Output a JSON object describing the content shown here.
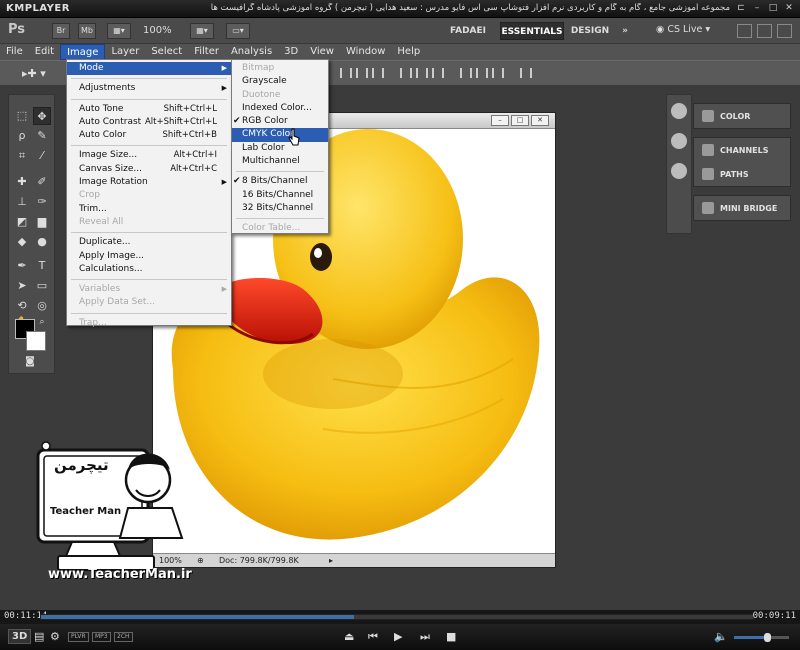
{
  "player": {
    "name": "KMPLAYER",
    "caption": "مجموعه آموزشی جامع ، گام به گام و کاربردی نرم افزار فتوشاپ سی اس فایو   مدرس : سعید هدایی ( تیچرمن ) گروه آموزشی پادشاه گرافیست ها",
    "time_elapsed": "00:11:14",
    "time_total": "00:09:11",
    "progress": 0.44,
    "volume": 0.6,
    "badges": [
      "PLVR",
      "MP3",
      "2CH"
    ],
    "btn_3d": "3D"
  },
  "appbar": {
    "logo": "Ps",
    "bridge_label": "Br",
    "minibridge_label": "Mb",
    "zoom": "100%",
    "workspaces": [
      "FADAEI",
      "ESSENTIALS",
      "DESIGN"
    ],
    "active_workspace": "ESSENTIALS",
    "more": "»",
    "cs_live": "CS Live"
  },
  "menubar": {
    "items": [
      "File",
      "Edit",
      "Image",
      "Layer",
      "Select",
      "Filter",
      "Analysis",
      "3D",
      "View",
      "Window",
      "Help"
    ],
    "open": "Image"
  },
  "image_menu": {
    "items": [
      {
        "label": "Mode",
        "shortcut": "",
        "submenu": true,
        "disabled": false,
        "highlighted": true
      },
      {
        "sep": true
      },
      {
        "label": "Adjustments",
        "shortcut": "",
        "submenu": true,
        "disabled": false
      },
      {
        "sep": true
      },
      {
        "label": "Auto Tone",
        "shortcut": "Shift+Ctrl+L"
      },
      {
        "label": "Auto Contrast",
        "shortcut": "Alt+Shift+Ctrl+L"
      },
      {
        "label": "Auto Color",
        "shortcut": "Shift+Ctrl+B"
      },
      {
        "sep": true
      },
      {
        "label": "Image Size...",
        "shortcut": "Alt+Ctrl+I"
      },
      {
        "label": "Canvas Size...",
        "shortcut": "Alt+Ctrl+C"
      },
      {
        "label": "Image Rotation",
        "shortcut": "",
        "submenu": true
      },
      {
        "label": "Crop",
        "shortcut": "",
        "disabled": true
      },
      {
        "label": "Trim...",
        "shortcut": ""
      },
      {
        "label": "Reveal All",
        "shortcut": "",
        "disabled": true
      },
      {
        "sep": true
      },
      {
        "label": "Duplicate...",
        "shortcut": ""
      },
      {
        "label": "Apply Image...",
        "shortcut": ""
      },
      {
        "label": "Calculations...",
        "shortcut": ""
      },
      {
        "sep": true
      },
      {
        "label": "Variables",
        "shortcut": "",
        "submenu": true,
        "disabled": true
      },
      {
        "label": "Apply Data Set...",
        "shortcut": "",
        "disabled": true
      },
      {
        "sep": true
      },
      {
        "label": "Trap...",
        "shortcut": "",
        "disabled": true
      }
    ]
  },
  "mode_menu": {
    "items": [
      {
        "label": "Bitmap",
        "disabled": true
      },
      {
        "label": "Grayscale"
      },
      {
        "label": "Duotone",
        "disabled": true
      },
      {
        "label": "Indexed Color..."
      },
      {
        "label": "RGB Color",
        "checked": true
      },
      {
        "label": "CMYK Color",
        "highlighted": true
      },
      {
        "label": "Lab Color"
      },
      {
        "label": "Multichannel"
      },
      {
        "sep": true
      },
      {
        "label": "8 Bits/Channel",
        "checked": true
      },
      {
        "label": "16 Bits/Channel"
      },
      {
        "label": "32 Bits/Channel"
      },
      {
        "sep": true
      },
      {
        "label": "Color Table...",
        "disabled": true
      }
    ]
  },
  "panels": {
    "group1": [
      "COLOR"
    ],
    "group2": [
      "CHANNELS",
      "PATHS"
    ],
    "group3": [
      "MINI BRIDGE"
    ]
  },
  "document": {
    "zoom": "100%",
    "doc_info": "Doc: 799.8K/799.8K"
  },
  "watermark": {
    "logo_text": "تیچرمن",
    "subtitle": "Teacher Man",
    "url": "www.TeacherMan.ir"
  },
  "colors": {
    "menu_highlight": "#2b5db3",
    "duck_yellow": "#f7c21a",
    "beak_red": "#d91f10"
  }
}
